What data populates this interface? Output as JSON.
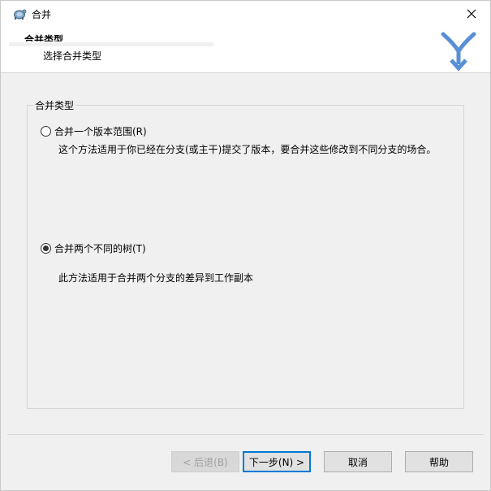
{
  "window": {
    "title": "合并"
  },
  "header": {
    "title": "合并类型",
    "subtitle": "选择合并类型"
  },
  "group": {
    "legend": "合并类型",
    "options": [
      {
        "label": "合并一个版本范围(R)",
        "description": "这个方法适用于你已经在分支(或主干)提交了版本，要合并这些修改到不同分支的场合。",
        "checked": false
      },
      {
        "label": "合并两个不同的树(T)",
        "description": "此方法适用于合并两个分支的差异到工作副本",
        "checked": true
      }
    ]
  },
  "buttons": {
    "back": "< 后退(B)",
    "next": "下一步(N) >",
    "cancel": "取消",
    "help": "帮助"
  },
  "colors": {
    "accent": "#0078d7",
    "logo": "#5a8fd6"
  },
  "icons": [
    "app-turtle-icon",
    "close-icon",
    "merge-logo-icon"
  ]
}
